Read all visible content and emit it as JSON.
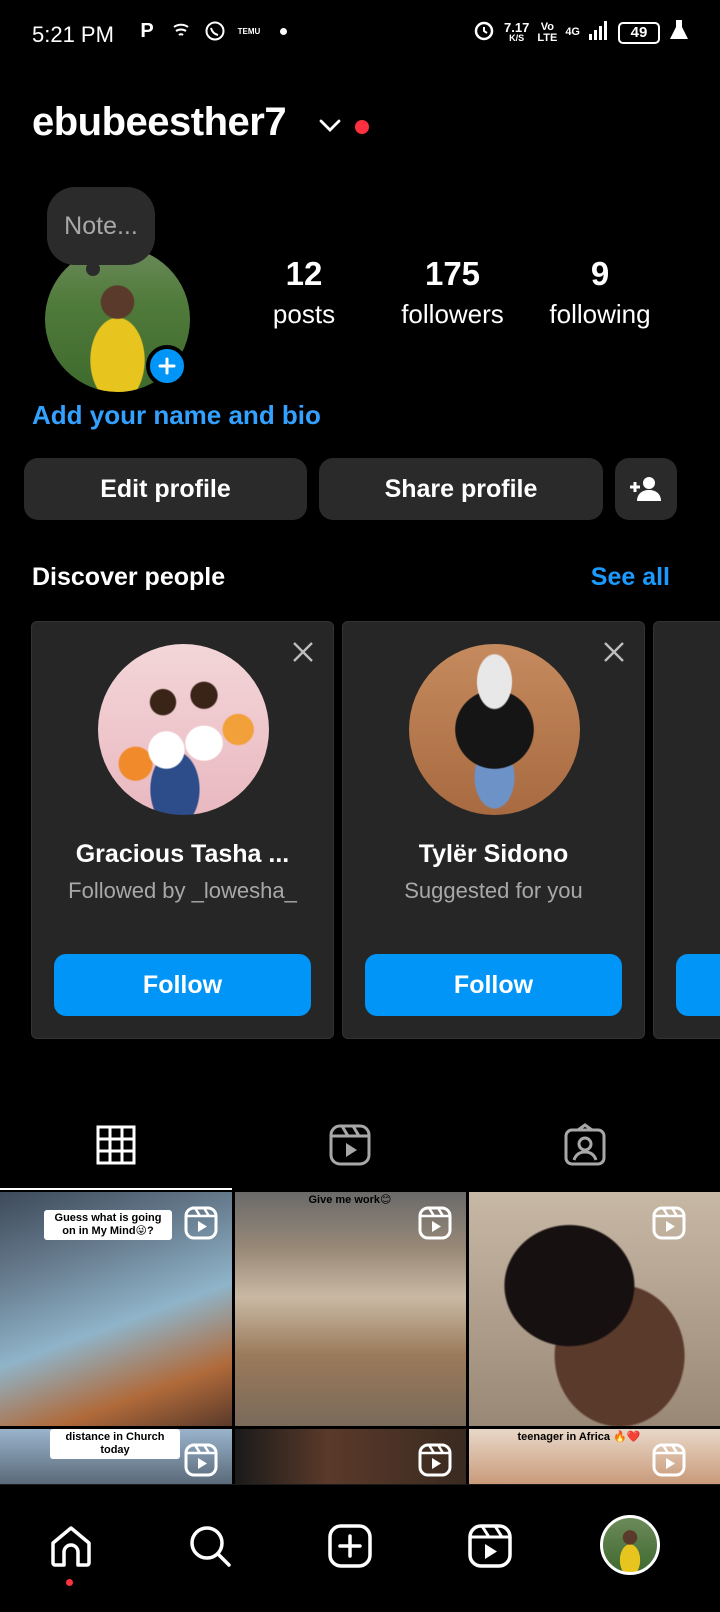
{
  "status_bar": {
    "time": "5:21 PM",
    "left_icons": [
      "p-icon",
      "signal-app-icon",
      "whatsapp-icon",
      "temu-icon",
      "dot-icon"
    ],
    "temu_label": "TEMU",
    "speed": "7.17",
    "speed_unit": "K/S",
    "volte_top": "Vo",
    "volte_bottom": "LTE",
    "network": "4G",
    "battery": "49"
  },
  "header": {
    "username": "ebubeesther7"
  },
  "profile": {
    "note_placeholder": "Note...",
    "stats": [
      {
        "value": "12",
        "label": "posts"
      },
      {
        "value": "175",
        "label": "followers"
      },
      {
        "value": "9",
        "label": "following"
      }
    ],
    "bio_link": "Add your name and bio",
    "edit_button": "Edit profile",
    "share_button": "Share profile"
  },
  "discover": {
    "title": "Discover people",
    "see_all": "See all",
    "cards": [
      {
        "name": "Gracious Tasha ...",
        "subtitle": "Followed by _lowesha_",
        "follow": "Follow"
      },
      {
        "name": "Tylër Sidono",
        "subtitle": "Suggested for you",
        "follow": "Follow"
      }
    ]
  },
  "tabs": [
    "grid-icon",
    "reels-icon",
    "tagged-icon"
  ],
  "posts": [
    {
      "caption": "Guess what is going on in My Mind😜?"
    },
    {
      "caption": "Give me work😊"
    },
    {
      "caption": ""
    },
    {
      "caption": "distance in Church today"
    },
    {
      "caption": ""
    },
    {
      "caption": "teenager in Africa 🔥❤️"
    }
  ],
  "bottom_nav": [
    "home-icon",
    "search-icon",
    "create-icon",
    "reels-icon",
    "profile-avatar"
  ],
  "colors": {
    "accent": "#0095f6",
    "link": "#33a1ff",
    "notify": "#ff3040",
    "surface": "#2a2a2a"
  }
}
